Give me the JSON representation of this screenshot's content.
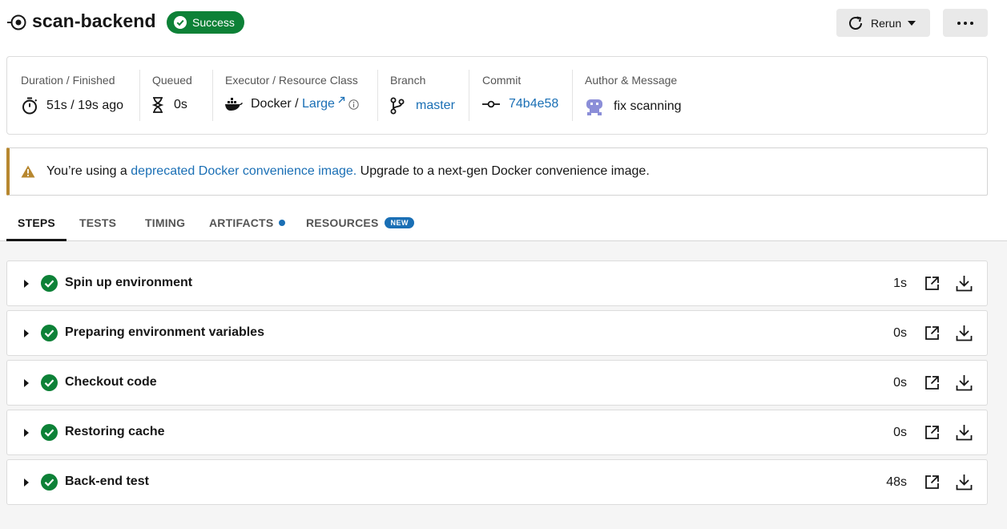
{
  "header": {
    "title": "scan-backend",
    "status": "Success",
    "rerun_label": "Rerun",
    "job_icon": "job-icon",
    "more_icon": "more-icon"
  },
  "info": {
    "duration": {
      "label": "Duration / Finished",
      "value": "51s / 19s ago",
      "icon": "stopwatch-icon"
    },
    "queued": {
      "label": "Queued",
      "value": "0s",
      "icon": "hourglass-icon"
    },
    "executor": {
      "label": "Executor / Resource Class",
      "executor": "Docker / ",
      "resource_class": "Large",
      "icon": "docker-icon"
    },
    "branch": {
      "label": "Branch",
      "value": "master",
      "icon": "branch-icon"
    },
    "commit": {
      "label": "Commit",
      "value": "74b4e58",
      "icon": "commit-icon"
    },
    "author": {
      "label": "Author & Message",
      "message": "fix scanning",
      "icon": "avatar"
    }
  },
  "warning": {
    "prefix": "You’re using a ",
    "link": "deprecated Docker convenience image.",
    "suffix": " Upgrade to a next-gen Docker convenience image."
  },
  "tabs": [
    {
      "label": "STEPS",
      "active": true
    },
    {
      "label": "TESTS"
    },
    {
      "label": "TIMING"
    },
    {
      "label": "ARTIFACTS"
    },
    {
      "label": "RESOURCES",
      "badge": "NEW"
    }
  ],
  "steps": [
    {
      "name": "Spin up environment",
      "duration": "1s"
    },
    {
      "name": "Preparing environment variables",
      "duration": "0s"
    },
    {
      "name": "Checkout code",
      "duration": "0s"
    },
    {
      "name": "Restoring cache",
      "duration": "0s"
    },
    {
      "name": "Back-end test",
      "duration": "48s"
    }
  ],
  "colors": {
    "success": "#0d8137",
    "link": "#1a6fb5",
    "warning_accent": "#b7872f"
  }
}
